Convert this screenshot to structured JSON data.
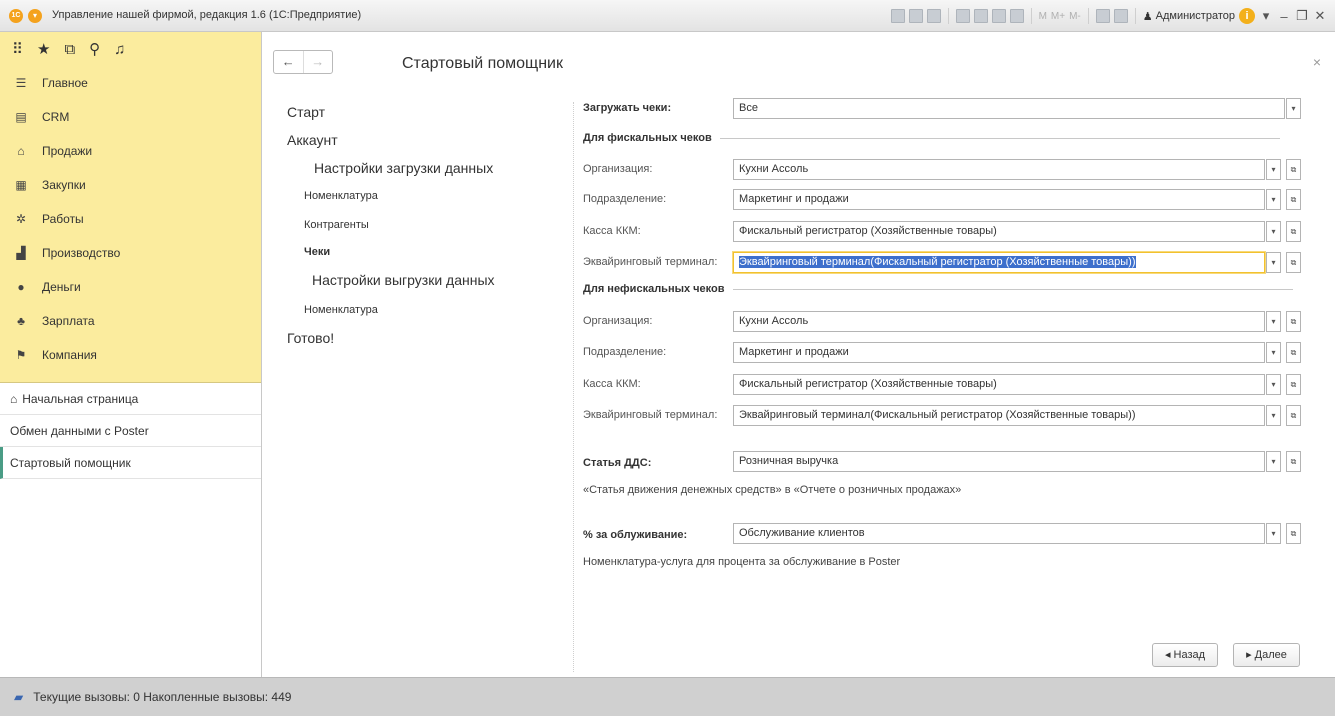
{
  "window": {
    "title": "Управление нашей фирмой, редакция 1.6  (1С:Предприятие)",
    "user": "Администратор",
    "m_buttons": [
      "M",
      "M+",
      "M-"
    ]
  },
  "sidebar": {
    "sections": [
      {
        "label": "Главное",
        "icon": "menu-lines-icon"
      },
      {
        "label": "CRM",
        "icon": "crm-card-icon"
      },
      {
        "label": "Продажи",
        "icon": "basket-icon"
      },
      {
        "label": "Закупки",
        "icon": "purchases-icon"
      },
      {
        "label": "Работы",
        "icon": "works-icon"
      },
      {
        "label": "Производство",
        "icon": "factory-icon"
      },
      {
        "label": "Деньги",
        "icon": "money-icon"
      },
      {
        "label": "Зарплата",
        "icon": "people-icon"
      },
      {
        "label": "Компания",
        "icon": "flag-icon"
      }
    ],
    "open_windows": [
      {
        "label": "Начальная страница",
        "icon": "home-icon"
      },
      {
        "label": "Обмен данными с Poster"
      },
      {
        "label": "Стартовый помощник"
      }
    ]
  },
  "main": {
    "title": "Стартовый помощник",
    "steps": [
      {
        "label": "Старт"
      },
      {
        "label": "Аккаунт"
      },
      {
        "label": "Настройки загрузки данных"
      },
      {
        "label": "Номенклатура"
      },
      {
        "label": "Контрагенты"
      },
      {
        "label": "Чеки"
      },
      {
        "label": "Настройки выгрузки данных"
      },
      {
        "label": "Номенклатура"
      },
      {
        "label": "Готово!"
      }
    ],
    "form": {
      "load_receipts_label": "Загружать чеки:",
      "load_receipts_value": "Все",
      "fiscal_group": "Для фискальных чеков",
      "nonfiscal_group": "Для нефискальных чеков",
      "fiscal": {
        "org_label": "Организация:",
        "org_value": "Кухни Ассоль",
        "dept_label": "Подразделение:",
        "dept_value": "Маркетинг и продажи",
        "kkm_label": "Касса ККМ:",
        "kkm_value": "Фискальный регистратор (Хозяйственные товары)",
        "terminal_label": "Эквайринговый терминал:",
        "terminal_value": "Эквайринговый терминал(Фискальный регистратор (Хозяйственные товары))"
      },
      "nonfiscal": {
        "org_label": "Организация:",
        "org_value": "Кухни Ассоль",
        "dept_label": "Подразделение:",
        "dept_value": "Маркетинг и продажи",
        "kkm_label": "Касса ККМ:",
        "kkm_value": "Фискальный регистратор (Хозяйственные товары)",
        "terminal_label": "Эквайринговый терминал:",
        "terminal_value": "Эквайринговый терминал(Фискальный регистратор (Хозяйственные товары))"
      },
      "dds_label": "Статья ДДС:",
      "dds_value": "Розничная выручка",
      "dds_hint": "«Статья движения денежных средств» в «Отчете о розничных продажах»",
      "service_label": "% за облуживание:",
      "service_value": "Обслуживание клиентов",
      "service_hint": "Номенклатура-услуга для процента за обслуживание в Poster"
    },
    "buttons": {
      "back": "◂  Назад",
      "next": "▸  Далее"
    }
  },
  "status": {
    "text": "Текущие вызовы: 0   Накопленные вызовы: 449"
  }
}
